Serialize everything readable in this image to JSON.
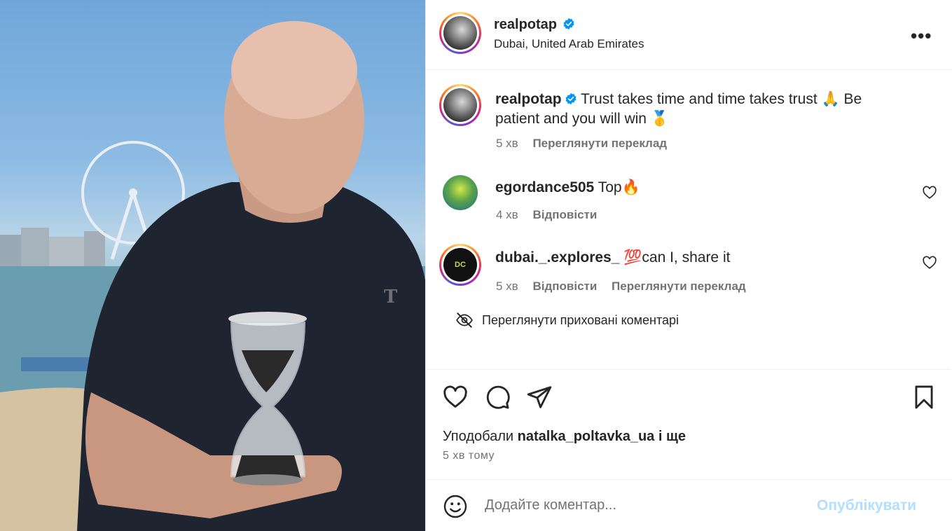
{
  "post": {
    "author": "realpotap",
    "location": "Dubai, United Arab Emirates",
    "more_label": "•••"
  },
  "caption": {
    "username": "realpotap",
    "text": " Trust takes time and time takes trust 🙏 Be patient and you will win 🥇",
    "time": "5 хв",
    "translate": "Переглянути переклад"
  },
  "comments": [
    {
      "username": "egordance505",
      "text": " Top🔥",
      "time": "4 хв",
      "reply": "Відповісти",
      "translate": ""
    },
    {
      "username": "dubai._.explores_",
      "text": " 💯can I, share it",
      "time": "5 хв",
      "reply": "Відповісти",
      "translate": "Переглянути переклад"
    }
  ],
  "hidden_comments": "Переглянути приховані коментарі",
  "likes": {
    "prefix": "Уподобали ",
    "user": "natalka_poltavka_ua",
    "suffix": " і ще"
  },
  "timestamp": "5 хв тому",
  "add_comment": {
    "placeholder": "Додайте коментар...",
    "post_label": "Опублікувати"
  },
  "colors": {
    "verified": "#0095f6",
    "post_disabled": "#b2dffc",
    "secondary_text": "#737373"
  },
  "icons": [
    "heart-icon",
    "comment-icon",
    "share-icon",
    "bookmark-icon",
    "emoji-icon",
    "eye-slash-icon",
    "verified-icon"
  ]
}
